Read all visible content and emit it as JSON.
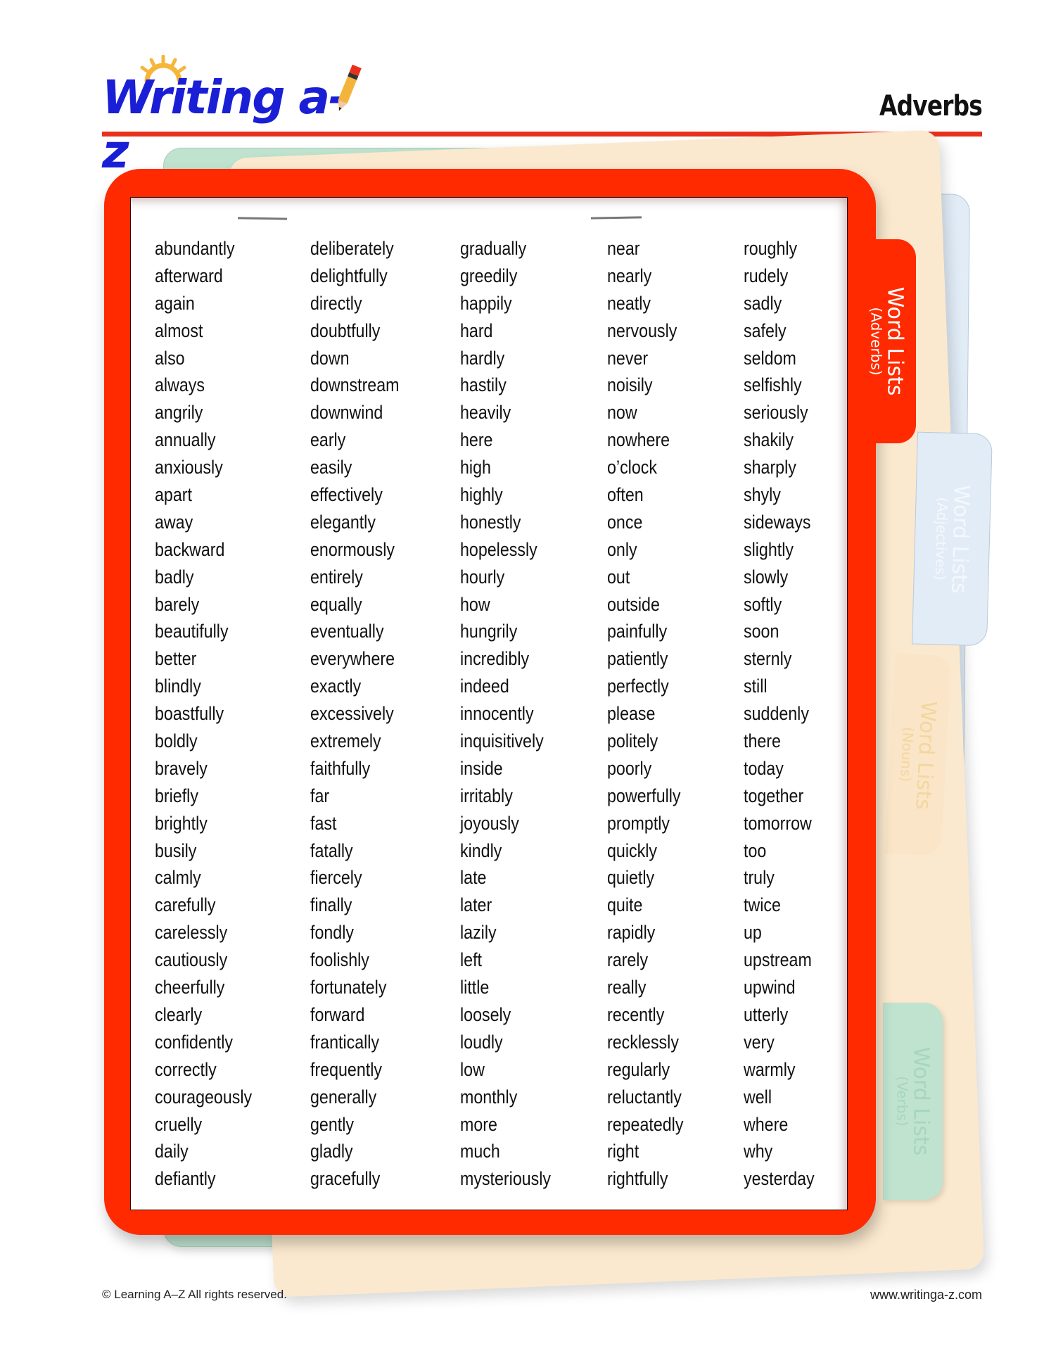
{
  "header": {
    "logo_text": "Writing a-z",
    "title": "Adverbs"
  },
  "tabs": {
    "adverbs": {
      "main": "Word Lists",
      "sub": "(Adverbs)"
    },
    "adjectives": {
      "main": "Word Lists",
      "sub": "(Adjectives)"
    },
    "nouns": {
      "main": "Word Lists",
      "sub": "(Nouns)"
    },
    "verbs": {
      "main": "Word Lists",
      "sub": "(Verbs)"
    }
  },
  "colors": {
    "brand_blue": "#1a1fd6",
    "accent_red": "#ff2a00",
    "rule_red": "#e8311c",
    "tab_green": "#bfe3cf",
    "tab_blue": "#e1ecf7",
    "tab_cream": "#fbe9cf"
  },
  "columns": [
    [
      "abundantly",
      "afterward",
      "again",
      "almost",
      "also",
      "always",
      "angrily",
      "annually",
      "anxiously",
      "apart",
      "away",
      "backward",
      "badly",
      "barely",
      "beautifully",
      "better",
      "blindly",
      "boastfully",
      "boldly",
      "bravely",
      "briefly",
      "brightly",
      "busily",
      "calmly",
      "carefully",
      "carelessly",
      "cautiously",
      "cheerfully",
      "clearly",
      "confidently",
      "correctly",
      "courageously",
      "cruelly",
      "daily",
      "defiantly"
    ],
    [
      "deliberately",
      "delightfully",
      "directly",
      "doubtfully",
      "down",
      "downstream",
      "downwind",
      "early",
      "easily",
      "effectively",
      "elegantly",
      "enormously",
      "entirely",
      "equally",
      "eventually",
      "everywhere",
      "exactly",
      "excessively",
      "extremely",
      "faithfully",
      "far",
      "fast",
      "fatally",
      "fiercely",
      "finally",
      "fondly",
      "foolishly",
      "fortunately",
      "forward",
      "frantically",
      "frequently",
      "generally",
      "gently",
      "gladly",
      "gracefully"
    ],
    [
      "gradually",
      "greedily",
      "happily",
      "hard",
      "hardly",
      "hastily",
      "heavily",
      "here",
      "high",
      "highly",
      "honestly",
      "hopelessly",
      "hourly",
      "how",
      "hungrily",
      "incredibly",
      "indeed",
      "innocently",
      "inquisitively",
      "inside",
      "irritably",
      "joyously",
      "kindly",
      "late",
      "later",
      "lazily",
      "left",
      "little",
      "loosely",
      "loudly",
      "low",
      "monthly",
      "more",
      "much",
      "mysteriously"
    ],
    [
      "near",
      "nearly",
      "neatly",
      "nervously",
      "never",
      "noisily",
      "now",
      "nowhere",
      "o’clock",
      "often",
      "once",
      "only",
      "out",
      "outside",
      "painfully",
      "patiently",
      "perfectly",
      "please",
      "politely",
      "poorly",
      "powerfully",
      "promptly",
      "quickly",
      "quietly",
      "quite",
      "rapidly",
      "rarely",
      "really",
      "recently",
      "recklessly",
      "regularly",
      "reluctantly",
      "repeatedly",
      "right",
      "rightfully"
    ],
    [
      "roughly",
      "rudely",
      "sadly",
      "safely",
      "seldom",
      "selfishly",
      "seriously",
      "shakily",
      "sharply",
      "shyly",
      "sideways",
      "slightly",
      "slowly",
      "softly",
      "soon",
      "sternly",
      "still",
      "suddenly",
      "there",
      "today",
      "together",
      "tomorrow",
      "too",
      "truly",
      "twice",
      "up",
      "upstream",
      "upwind",
      "utterly",
      "very",
      "warmly",
      "well",
      "where",
      "why",
      "yesterday"
    ]
  ],
  "footer": {
    "copyright": "© Learning A–Z   All rights reserved.",
    "url": "www.writinga-z.com"
  }
}
